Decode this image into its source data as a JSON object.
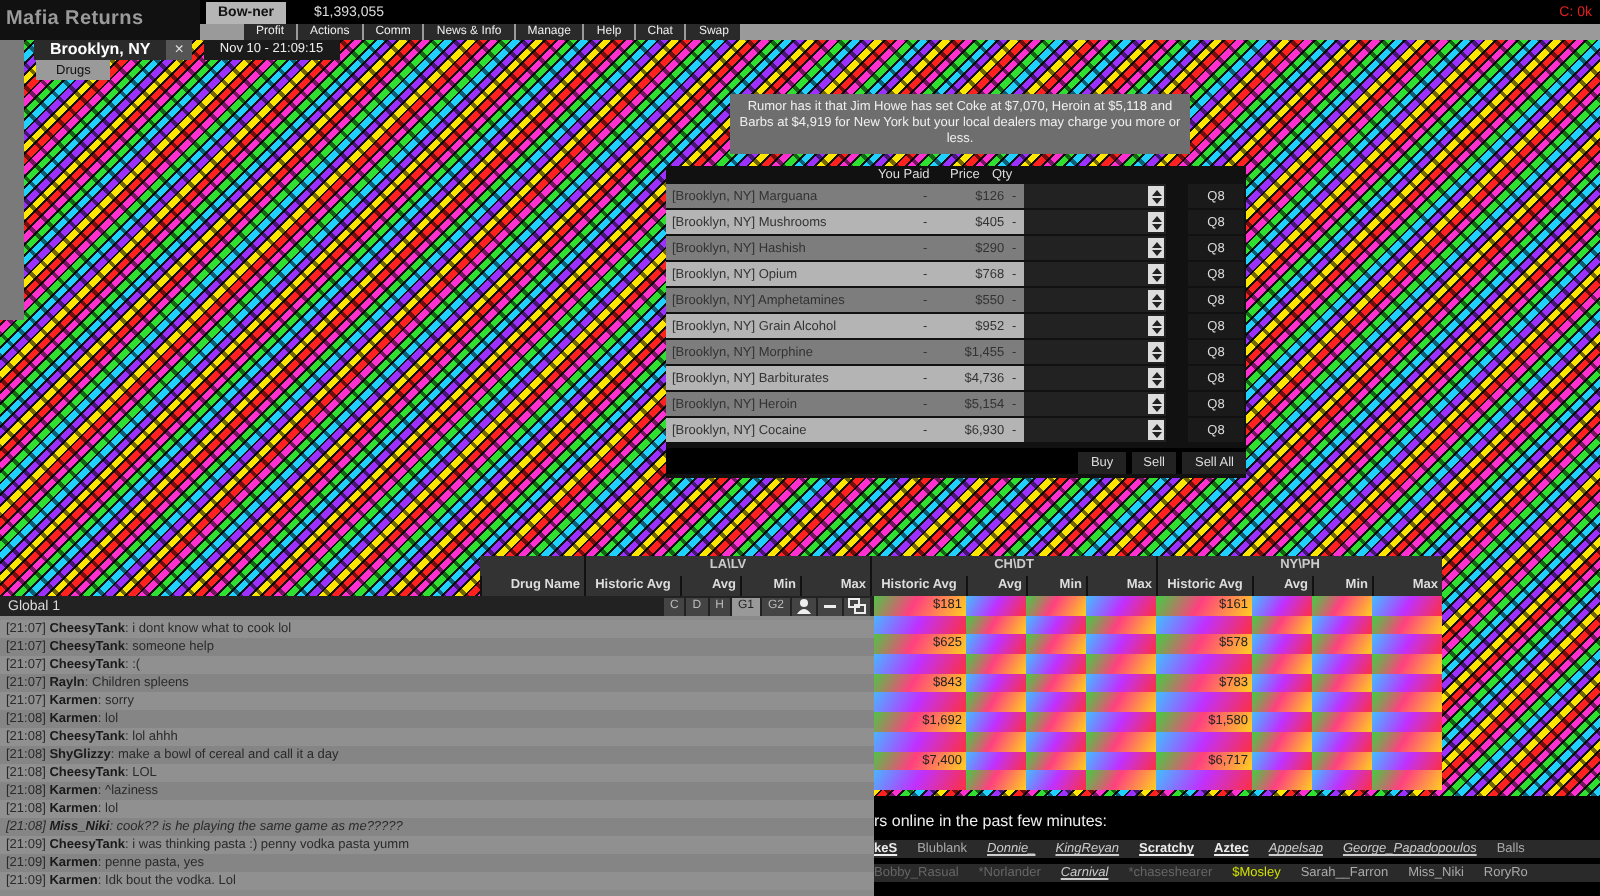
{
  "header": {
    "logo": "Mafia Returns",
    "player_tab": "Bow-ner",
    "cash": "$1,393,055",
    "status": "C: 0k"
  },
  "nav": [
    "Profit",
    "Actions",
    "Comm",
    "News & Info",
    "Manage",
    "Help",
    "Chat",
    "Swap"
  ],
  "location": {
    "city": "Brooklyn, NY",
    "close": "×",
    "datetime": "Nov 10 - 21:09:15"
  },
  "page_tabs": [
    {
      "label": "Drugs",
      "selected": true
    }
  ],
  "rumor": "Rumor has it that Jim Howe has set Coke at $7,070, Heroin at $5,118 and Barbs at $4,919 for New York but your local dealers may charge you more or less.",
  "drug_market": {
    "columns": [
      "You Paid",
      "Price",
      "Qty"
    ],
    "rows": [
      {
        "name": "[Brooklyn, NY] Marguana",
        "paid": "-",
        "price": "$126",
        "qty": "-",
        "max": "Q8"
      },
      {
        "name": "[Brooklyn, NY] Mushrooms",
        "paid": "-",
        "price": "$405",
        "qty": "-",
        "max": "Q8"
      },
      {
        "name": "[Brooklyn, NY] Hashish",
        "paid": "-",
        "price": "$290",
        "qty": "-",
        "max": "Q8"
      },
      {
        "name": "[Brooklyn, NY] Opium",
        "paid": "-",
        "price": "$768",
        "qty": "-",
        "max": "Q8"
      },
      {
        "name": "[Brooklyn, NY] Amphetamines",
        "paid": "-",
        "price": "$550",
        "qty": "-",
        "max": "Q8"
      },
      {
        "name": "[Brooklyn, NY] Grain Alcohol",
        "paid": "-",
        "price": "$952",
        "qty": "-",
        "max": "Q8"
      },
      {
        "name": "[Brooklyn, NY] Morphine",
        "paid": "-",
        "price": "$1,455",
        "qty": "-",
        "max": "Q8"
      },
      {
        "name": "[Brooklyn, NY] Barbiturates",
        "paid": "-",
        "price": "$4,736",
        "qty": "-",
        "max": "Q8"
      },
      {
        "name": "[Brooklyn, NY] Heroin",
        "paid": "-",
        "price": "$5,154",
        "qty": "-",
        "max": "Q8"
      },
      {
        "name": "[Brooklyn, NY] Cocaine",
        "paid": "-",
        "price": "$6,930",
        "qty": "-",
        "max": "Q8"
      }
    ],
    "buttons": [
      "Buy",
      "Sell",
      "Sell All"
    ]
  },
  "price_table": {
    "first_column": "Drug Name",
    "groups": [
      {
        "label": "LA\\LV",
        "columns": [
          "Historic Avg",
          "Avg",
          "Min",
          "Max"
        ]
      },
      {
        "label": "CH\\DT",
        "columns": [
          "Historic Avg",
          "Avg",
          "Min",
          "Max"
        ]
      },
      {
        "label": "NY\\PH",
        "columns": [
          "Historic Avg",
          "Avg",
          "Min",
          "Max"
        ]
      }
    ],
    "rows": [
      {
        "ch_historic_avg": "$181",
        "ny_historic_avg": "$161"
      },
      {},
      {
        "ch_historic_avg": "$625",
        "ny_historic_avg": "$578"
      },
      {},
      {
        "ch_historic_avg": "$843",
        "ny_historic_avg": "$783"
      },
      {},
      {
        "ch_historic_avg": "$1,692",
        "ny_historic_avg": "$1,580"
      },
      {},
      {
        "ch_historic_avg": "$7,400",
        "ny_historic_avg": "$6,717"
      },
      {}
    ]
  },
  "chat": {
    "title": "Global 1",
    "tabs": [
      {
        "label": "C",
        "selected": false
      },
      {
        "label": "D",
        "selected": false
      },
      {
        "label": "H",
        "selected": false
      },
      {
        "label": "G1",
        "selected": true
      },
      {
        "label": "G2",
        "selected": false
      }
    ],
    "messages": [
      {
        "kind": "say",
        "text": "[21:07] **CheesyTank**: i dont know what to cook lol"
      },
      {
        "kind": "say",
        "text": "[21:07] **CheesyTank**: someone help"
      },
      {
        "kind": "say",
        "text": "[21:07] **CheesyTank**: :("
      },
      {
        "kind": "say",
        "text": "[21:07] **Rayln**: Children spleens"
      },
      {
        "kind": "say",
        "text": "[21:07] **Karmen**: sorry"
      },
      {
        "kind": "say",
        "text": "[21:08] **Karmen**: lol"
      },
      {
        "kind": "say",
        "text": "[21:08] **CheesyTank**: lol ahhh"
      },
      {
        "kind": "say",
        "text": "[21:08] **ShyGlizzy**: make a bowl of cereal and call it a day"
      },
      {
        "kind": "say",
        "text": "[21:08] **CheesyTank**: LOL"
      },
      {
        "kind": "say",
        "text": "[21:08] **Karmen**: ^laziness"
      },
      {
        "kind": "say",
        "text": "[21:08] **Karmen**: lol"
      },
      {
        "kind": "emote",
        "text": "[21:08] **Miss_Niki**: cook?? is he playing the same game as me?????"
      },
      {
        "kind": "say",
        "text": "[21:09] **CheesyTank**: i was thinking pasta :) penny vodka pasta yumm"
      },
      {
        "kind": "say",
        "text": "[21:09] **Karmen**: penne pasta, yes"
      },
      {
        "kind": "say",
        "text": "[21:09] **Karmen**: Idk bout the vodka. Lol"
      }
    ]
  },
  "online": {
    "heading": "rs online in the past few minutes:",
    "users": [
      [
        {
          "name": "keS",
          "kind": "bold"
        },
        {
          "name": "Blublank",
          "kind": "plain"
        },
        {
          "name": "Donnie_",
          "kind": "link"
        },
        {
          "name": "KingReyan",
          "kind": "link"
        },
        {
          "name": "Scratchy",
          "kind": "bold"
        },
        {
          "name": "Aztec",
          "kind": "bold"
        },
        {
          "name": "Appelsap",
          "kind": "link"
        },
        {
          "name": "George_Papadopoulos",
          "kind": "link"
        },
        {
          "name": "Balls",
          "kind": "plain"
        }
      ],
      [
        {
          "name": "Bobby_Rasual",
          "kind": "dim"
        },
        {
          "name": "*Norlander",
          "kind": "dim"
        },
        {
          "name": "Carnival",
          "kind": "link"
        },
        {
          "name": "*chaseshearer",
          "kind": "dim"
        },
        {
          "name": "$Mosley",
          "kind": "highlight"
        },
        {
          "name": "Sarah__Farron",
          "kind": "plain"
        },
        {
          "name": "Miss_Niki",
          "kind": "plain"
        },
        {
          "name": "RoryRo",
          "kind": "plain"
        }
      ]
    ]
  }
}
